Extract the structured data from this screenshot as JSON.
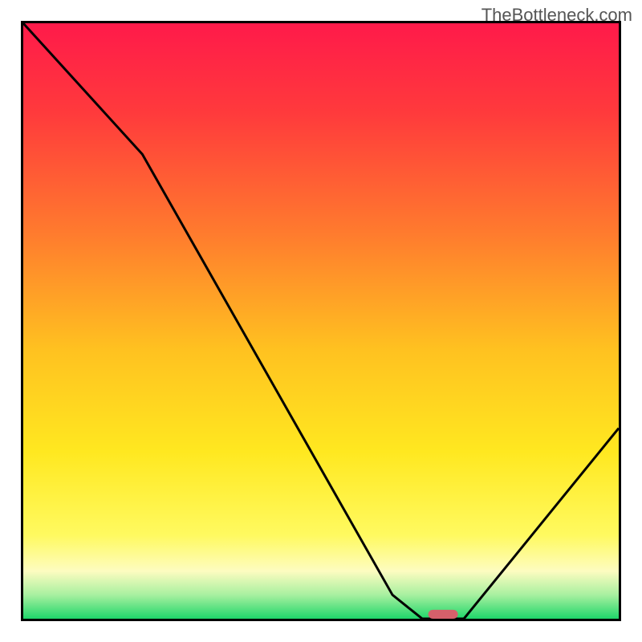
{
  "watermark": "TheBottleneck.com",
  "chart_data": {
    "type": "line",
    "title": "",
    "xlabel": "",
    "ylabel": "",
    "xlim": [
      0,
      100
    ],
    "ylim": [
      0,
      100
    ],
    "x": [
      0,
      20,
      62,
      67,
      74,
      100
    ],
    "values": [
      100,
      78,
      4,
      0,
      0,
      32
    ],
    "gradient_stops": [
      {
        "offset": 0.0,
        "color": "#ff1a4a"
      },
      {
        "offset": 0.15,
        "color": "#ff3a3c"
      },
      {
        "offset": 0.35,
        "color": "#ff7a2e"
      },
      {
        "offset": 0.55,
        "color": "#ffc220"
      },
      {
        "offset": 0.72,
        "color": "#ffe820"
      },
      {
        "offset": 0.86,
        "color": "#fffa60"
      },
      {
        "offset": 0.92,
        "color": "#fdfcc0"
      },
      {
        "offset": 0.96,
        "color": "#a8f0a0"
      },
      {
        "offset": 1.0,
        "color": "#1fd66a"
      }
    ],
    "marker": {
      "x": 70.5,
      "color": "#d6606b",
      "width_frac": 0.05,
      "height_frac": 0.015
    },
    "frame_color": "#000000",
    "line_color": "#000000"
  }
}
